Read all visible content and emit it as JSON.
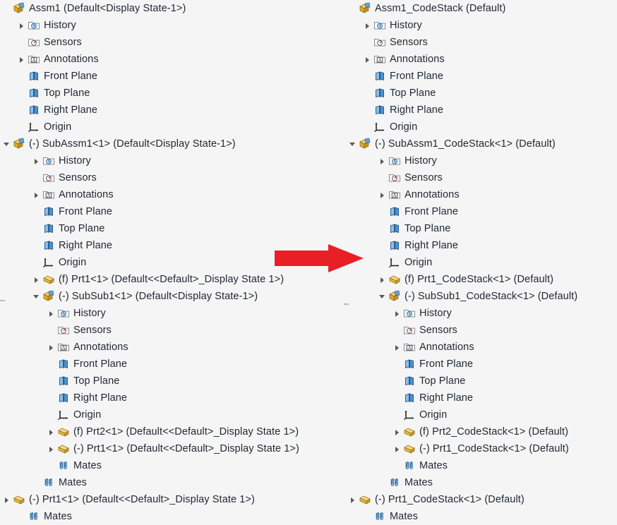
{
  "colors": {
    "background": "#f5f5f5",
    "text": "#1f2733",
    "arrow_red": "#e81f25",
    "assembly_icon_yellow": "#f0b429",
    "part_icon_yellow": "#f2c14e",
    "plane_icon_blue": "#4a8fd0",
    "folder_icon_gray": "#9a9a9a",
    "mates_icon_blue": "#2f6ea5",
    "twisty_gray": "#595959"
  },
  "arrow": {
    "name": "red-right-arrow",
    "direction": "right"
  },
  "left_tree": {
    "name": "original-feature-tree",
    "rows": [
      {
        "indent": 0,
        "twisty": "none",
        "icon": "assembly-icon",
        "label": "Assm1  (Default<Display State-1>)"
      },
      {
        "indent": 1,
        "twisty": "collapsed",
        "icon": "history-icon",
        "label": "History"
      },
      {
        "indent": 1,
        "twisty": "none",
        "icon": "sensors-icon",
        "label": "Sensors"
      },
      {
        "indent": 1,
        "twisty": "collapsed",
        "icon": "annotations-icon",
        "label": "Annotations"
      },
      {
        "indent": 1,
        "twisty": "none",
        "icon": "plane-icon",
        "label": "Front Plane"
      },
      {
        "indent": 1,
        "twisty": "none",
        "icon": "plane-icon",
        "label": "Top Plane"
      },
      {
        "indent": 1,
        "twisty": "none",
        "icon": "plane-icon",
        "label": "Right Plane"
      },
      {
        "indent": 1,
        "twisty": "none",
        "icon": "origin-icon",
        "label": "Origin"
      },
      {
        "indent": 0,
        "twisty": "expanded",
        "icon": "assembly-icon",
        "label": "(-) SubAssm1<1>  (Default<Display State-1>)"
      },
      {
        "indent": 2,
        "twisty": "collapsed",
        "icon": "history-icon",
        "label": "History"
      },
      {
        "indent": 2,
        "twisty": "none",
        "icon": "sensors-icon",
        "label": "Sensors"
      },
      {
        "indent": 2,
        "twisty": "collapsed",
        "icon": "annotations-icon",
        "label": "Annotations"
      },
      {
        "indent": 2,
        "twisty": "none",
        "icon": "plane-icon",
        "label": "Front Plane"
      },
      {
        "indent": 2,
        "twisty": "none",
        "icon": "plane-icon",
        "label": "Top Plane"
      },
      {
        "indent": 2,
        "twisty": "none",
        "icon": "plane-icon",
        "label": "Right Plane"
      },
      {
        "indent": 2,
        "twisty": "none",
        "icon": "origin-icon",
        "label": "Origin"
      },
      {
        "indent": 2,
        "twisty": "collapsed",
        "icon": "part-icon",
        "label": "(f) Prt1<1>  (Default<<Default>_Display State 1>)"
      },
      {
        "indent": 2,
        "twisty": "expanded",
        "icon": "assembly-icon",
        "label": "(-) SubSub1<1>  (Default<Display State-1>)"
      },
      {
        "indent": 3,
        "twisty": "collapsed",
        "icon": "history-icon",
        "label": "History"
      },
      {
        "indent": 3,
        "twisty": "none",
        "icon": "sensors-icon",
        "label": "Sensors"
      },
      {
        "indent": 3,
        "twisty": "collapsed",
        "icon": "annotations-icon",
        "label": "Annotations"
      },
      {
        "indent": 3,
        "twisty": "none",
        "icon": "plane-icon",
        "label": "Front Plane"
      },
      {
        "indent": 3,
        "twisty": "none",
        "icon": "plane-icon",
        "label": "Top Plane"
      },
      {
        "indent": 3,
        "twisty": "none",
        "icon": "plane-icon",
        "label": "Right Plane"
      },
      {
        "indent": 3,
        "twisty": "none",
        "icon": "origin-icon",
        "label": "Origin"
      },
      {
        "indent": 3,
        "twisty": "collapsed",
        "icon": "part-icon",
        "label": "(f) Prt2<1>  (Default<<Default>_Display State 1>)"
      },
      {
        "indent": 3,
        "twisty": "collapsed",
        "icon": "part-icon",
        "label": "(-) Prt1<1>  (Default<<Default>_Display State 1>)"
      },
      {
        "indent": 3,
        "twisty": "none",
        "icon": "mates-icon",
        "label": "Mates"
      },
      {
        "indent": 2,
        "twisty": "none",
        "icon": "mates-icon",
        "label": "Mates"
      },
      {
        "indent": 0,
        "twisty": "collapsed",
        "icon": "part-icon",
        "label": "(-) Prt1<1>  (Default<<Default>_Display State 1>)"
      },
      {
        "indent": 1,
        "twisty": "none",
        "icon": "mates-icon",
        "label": "Mates"
      }
    ]
  },
  "right_tree": {
    "name": "codestack-feature-tree",
    "rows": [
      {
        "indent": 0,
        "twisty": "none",
        "icon": "assembly-icon",
        "label": "Assm1_CodeStack  (Default)"
      },
      {
        "indent": 1,
        "twisty": "collapsed",
        "icon": "history-icon",
        "label": "History"
      },
      {
        "indent": 1,
        "twisty": "none",
        "icon": "sensors-icon",
        "label": "Sensors"
      },
      {
        "indent": 1,
        "twisty": "collapsed",
        "icon": "annotations-icon",
        "label": "Annotations"
      },
      {
        "indent": 1,
        "twisty": "none",
        "icon": "plane-icon",
        "label": "Front Plane"
      },
      {
        "indent": 1,
        "twisty": "none",
        "icon": "plane-icon",
        "label": "Top Plane"
      },
      {
        "indent": 1,
        "twisty": "none",
        "icon": "plane-icon",
        "label": "Right Plane"
      },
      {
        "indent": 1,
        "twisty": "none",
        "icon": "origin-icon",
        "label": "Origin"
      },
      {
        "indent": 0,
        "twisty": "expanded",
        "icon": "assembly-icon",
        "label": "(-) SubAssm1_CodeStack<1>  (Default)"
      },
      {
        "indent": 2,
        "twisty": "collapsed",
        "icon": "history-icon",
        "label": "History"
      },
      {
        "indent": 2,
        "twisty": "none",
        "icon": "sensors-icon",
        "label": "Sensors"
      },
      {
        "indent": 2,
        "twisty": "collapsed",
        "icon": "annotations-icon",
        "label": "Annotations"
      },
      {
        "indent": 2,
        "twisty": "none",
        "icon": "plane-icon",
        "label": "Front Plane"
      },
      {
        "indent": 2,
        "twisty": "none",
        "icon": "plane-icon",
        "label": "Top Plane"
      },
      {
        "indent": 2,
        "twisty": "none",
        "icon": "plane-icon",
        "label": "Right Plane"
      },
      {
        "indent": 2,
        "twisty": "none",
        "icon": "origin-icon",
        "label": "Origin"
      },
      {
        "indent": 2,
        "twisty": "collapsed",
        "icon": "part-icon",
        "label": "(f) Prt1_CodeStack<1>  (Default)"
      },
      {
        "indent": 2,
        "twisty": "expanded",
        "icon": "assembly-icon",
        "label": "(-) SubSub1_CodeStack<1>  (Default)"
      },
      {
        "indent": 3,
        "twisty": "collapsed",
        "icon": "history-icon",
        "label": "History"
      },
      {
        "indent": 3,
        "twisty": "none",
        "icon": "sensors-icon",
        "label": "Sensors"
      },
      {
        "indent": 3,
        "twisty": "collapsed",
        "icon": "annotations-icon",
        "label": "Annotations"
      },
      {
        "indent": 3,
        "twisty": "none",
        "icon": "plane-icon",
        "label": "Front Plane"
      },
      {
        "indent": 3,
        "twisty": "none",
        "icon": "plane-icon",
        "label": "Top Plane"
      },
      {
        "indent": 3,
        "twisty": "none",
        "icon": "plane-icon",
        "label": "Right Plane"
      },
      {
        "indent": 3,
        "twisty": "none",
        "icon": "origin-icon",
        "label": "Origin"
      },
      {
        "indent": 3,
        "twisty": "collapsed",
        "icon": "part-icon",
        "label": "(f) Prt2_CodeStack<1>  (Default)"
      },
      {
        "indent": 3,
        "twisty": "collapsed",
        "icon": "part-icon",
        "label": "(-) Prt1_CodeStack<1>  (Default)"
      },
      {
        "indent": 3,
        "twisty": "none",
        "icon": "mates-icon",
        "label": "Mates"
      },
      {
        "indent": 2,
        "twisty": "none",
        "icon": "mates-icon",
        "label": "Mates"
      },
      {
        "indent": 0,
        "twisty": "collapsed",
        "icon": "part-icon",
        "label": "(-) Prt1_CodeStack<1>  (Default)"
      },
      {
        "indent": 1,
        "twisty": "none",
        "icon": "mates-icon",
        "label": "Mates"
      }
    ]
  }
}
